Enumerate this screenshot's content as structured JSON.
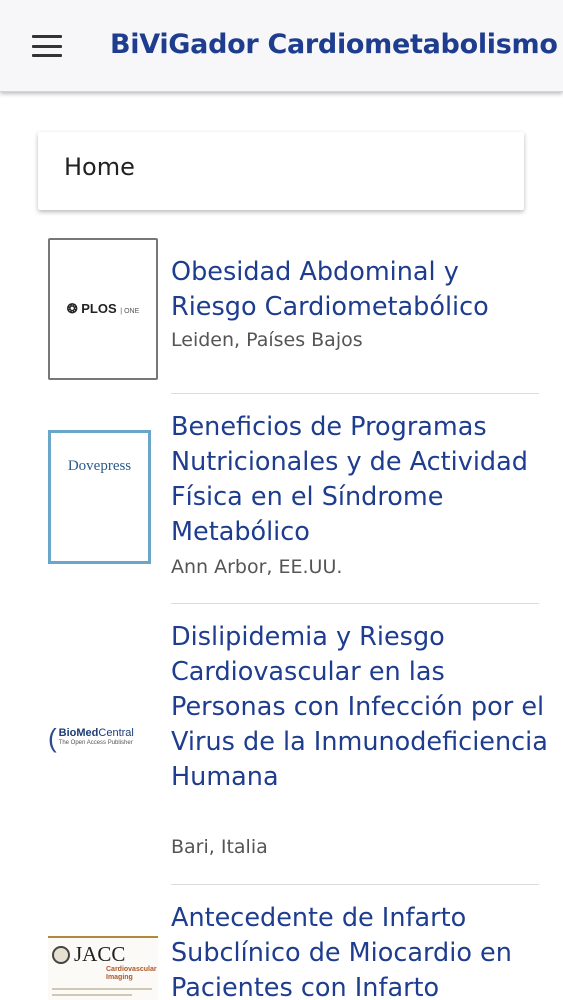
{
  "app_bar": {
    "title": "BiViGador Cardiometabolismo",
    "menu_icon": "hamburger-menu-icon"
  },
  "breadcrumb": {
    "label": "Home"
  },
  "articles": [
    {
      "title": "Obesidad Abdominal y Riesgo Cardiometabólico",
      "location": "Leiden, Países Bajos",
      "thumbnail": {
        "logo_text": "PLOS",
        "logo_suffix": "ONE"
      }
    },
    {
      "title": "Beneficios de Programas Nutricionales y de Actividad Física en el Síndrome Metabólico",
      "location": "Ann Arbor, EE.UU.",
      "thumbnail": {
        "logo_text": "Dovepress"
      }
    },
    {
      "title": "Dislipidemia y Riesgo Cardiovascular en las Personas con Infección por el Virus de la Inmunodeficiencia Humana",
      "location": "Bari, Italia",
      "thumbnail": {
        "logo_text": "BioMed",
        "logo_text_2": "Central",
        "logo_sub": "The Open Access Publisher"
      }
    },
    {
      "title": "Antecedente de Infarto Subclínico de Miocardio en Pacientes con Infarto",
      "location": "",
      "thumbnail": {
        "logo_text": "JACC",
        "logo_sub": "Cardiovascular Imaging"
      }
    }
  ],
  "colors": {
    "title_blue": "#1e3d8f",
    "appbar_bg": "#f7f7f9",
    "location_gray": "#555555"
  }
}
